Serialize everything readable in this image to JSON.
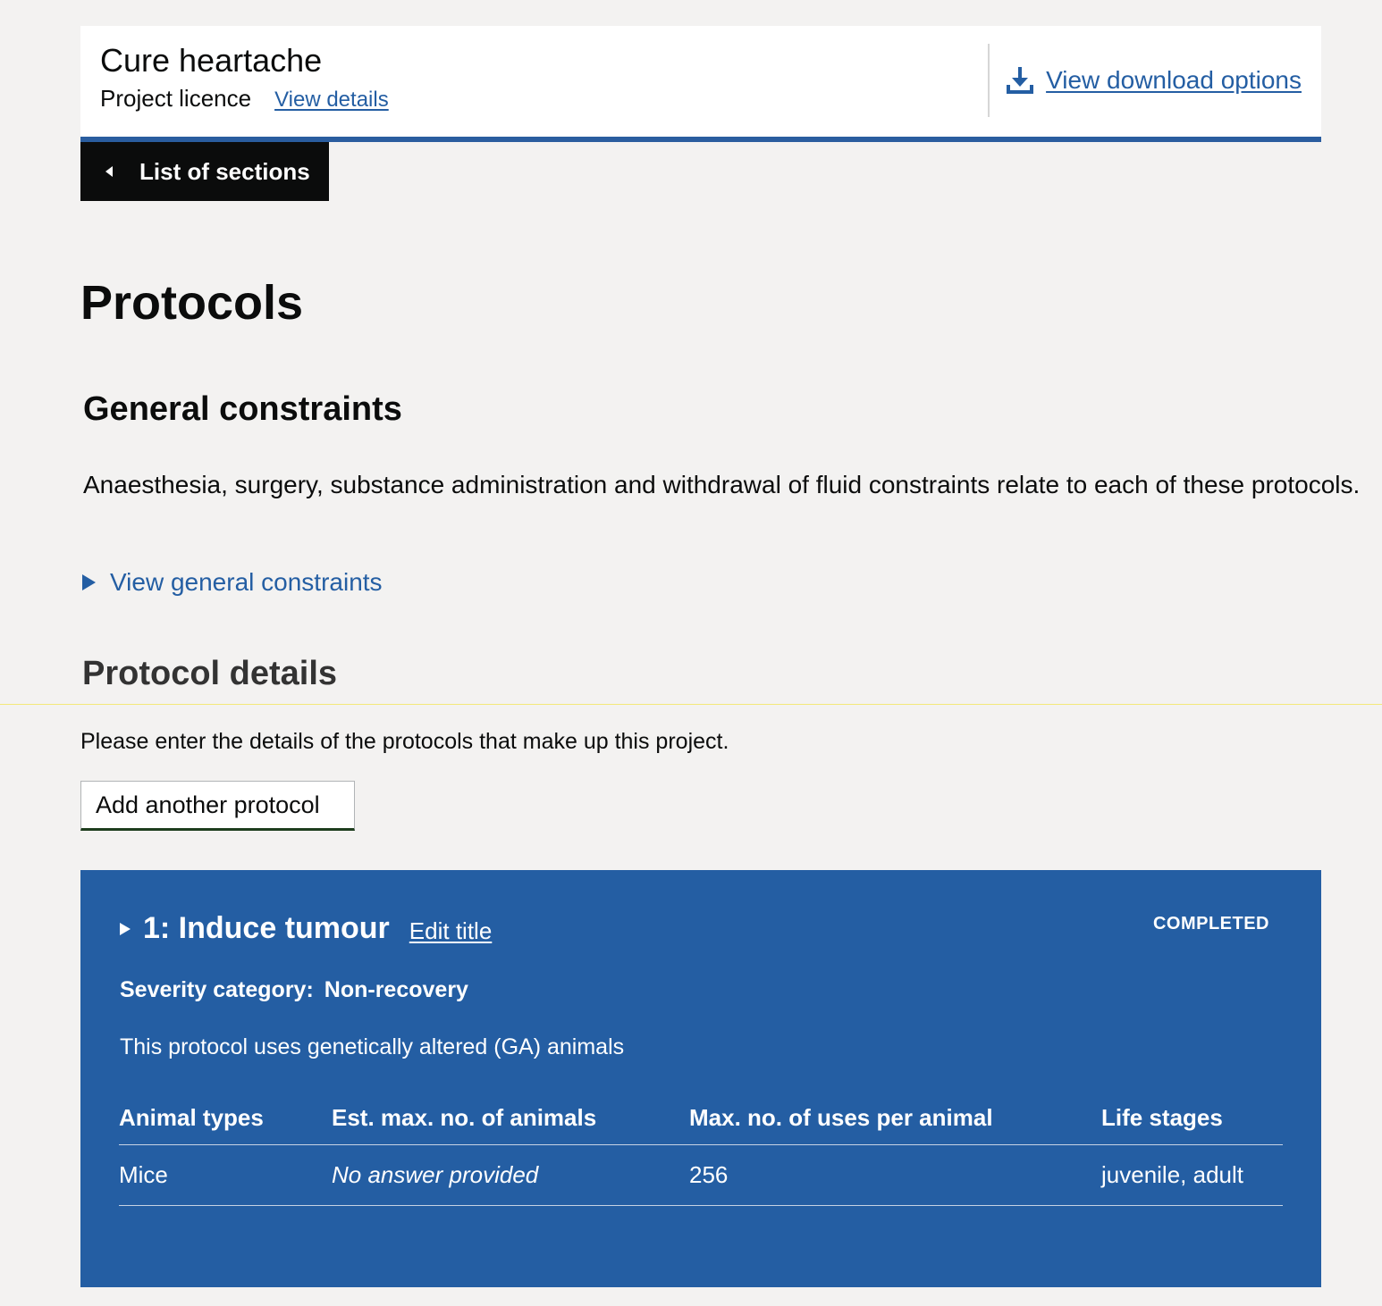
{
  "header": {
    "project_title": "Cure heartache",
    "licence_type": "Project licence",
    "view_details": "View details",
    "download_label": "View download options",
    "download_icon": "download-icon"
  },
  "nav": {
    "back_label": "List of sections",
    "back_icon": "caret-left-icon"
  },
  "page": {
    "title": "Protocols"
  },
  "general_constraints": {
    "heading": "General constraints",
    "text": "Anaesthesia, surgery, substance administration and withdrawal of fluid constraints relate to each of these protocols.",
    "toggle_label": "View general constraints"
  },
  "protocol_details": {
    "heading": "Protocol details",
    "text": "Please enter the details of the protocols that make up this project.",
    "add_button": "Add another protocol"
  },
  "protocols": [
    {
      "title": "1: Induce tumour",
      "edit_label": "Edit title",
      "status": "COMPLETED",
      "severity_label": "Severity category:",
      "severity_value": "Non-recovery",
      "ga_text": "This protocol uses genetically altered (GA) animals",
      "table": {
        "headers": [
          "Animal types",
          "Est. max. no. of animals",
          "Max. no. of uses per animal",
          "Life stages"
        ],
        "rows": [
          [
            "Mice",
            "No answer provided",
            "256",
            "juvenile, adult"
          ]
        ]
      }
    }
  ],
  "colors": {
    "accent": "#245ea3",
    "background": "#f3f2f1",
    "back_button": "#0b0c0c"
  }
}
